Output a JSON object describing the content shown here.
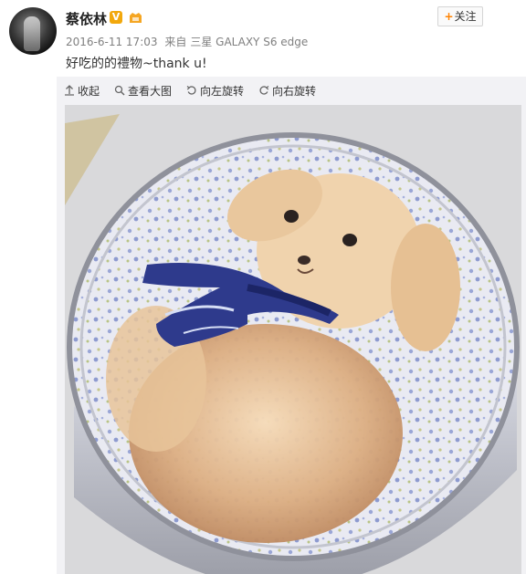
{
  "post": {
    "username": "蔡依林",
    "verified_badge": "V",
    "timestamp": "2016-6-11 17:03",
    "source_prefix": "来自",
    "source_device": "三星 GALAXY S6 edge",
    "text": "好吃的的禮物~thank u!",
    "follow_label": "关注"
  },
  "toolbar": {
    "collapse": "收起",
    "view_large": "查看大图",
    "rotate_left": "向左旋转",
    "rotate_right": "向右旋转"
  },
  "icons": {
    "collapse": "arrow-up-icon",
    "view_large": "magnifier-icon",
    "rotate_left": "rotate-left-icon",
    "rotate_right": "rotate-right-icon",
    "follow": "plus-icon"
  },
  "colors": {
    "accent_orange": "#ff8200",
    "badge_gold": "#f2a80c",
    "meta_gray": "#808080"
  }
}
